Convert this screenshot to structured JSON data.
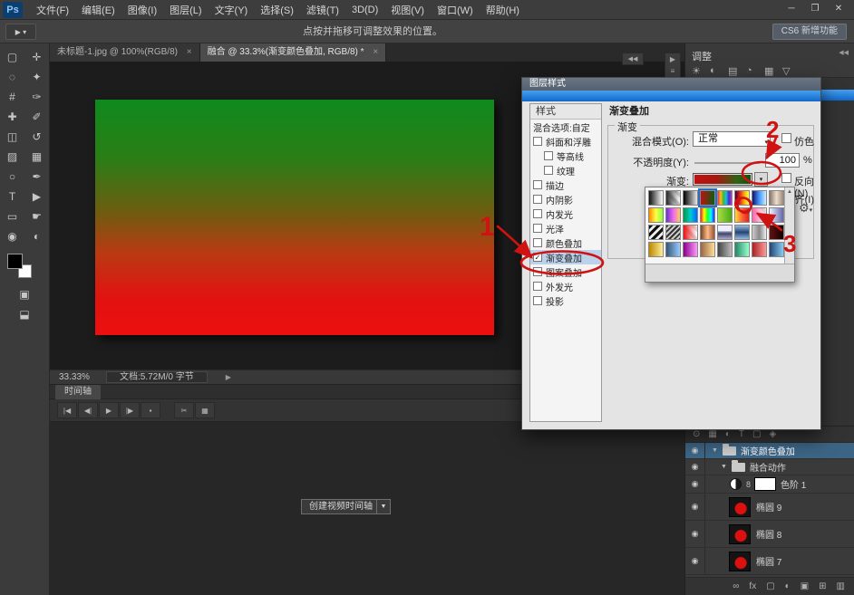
{
  "window": {
    "logo": "Ps",
    "controls": [
      {
        "name": "minimize",
        "glyph": "─"
      },
      {
        "name": "restore",
        "glyph": "❐"
      },
      {
        "name": "close",
        "glyph": "✕"
      }
    ]
  },
  "menu": {
    "items": [
      {
        "name": "file",
        "label": "文件(F)"
      },
      {
        "name": "edit",
        "label": "编辑(E)"
      },
      {
        "name": "image",
        "label": "图像(I)"
      },
      {
        "name": "layer",
        "label": "图层(L)"
      },
      {
        "name": "type",
        "label": "文字(Y)"
      },
      {
        "name": "select",
        "label": "选择(S)"
      },
      {
        "name": "filter",
        "label": "滤镜(T)"
      },
      {
        "name": "3d",
        "label": "3D(D)"
      },
      {
        "name": "view",
        "label": "视图(V)"
      },
      {
        "name": "window",
        "label": "窗口(W)"
      },
      {
        "name": "help",
        "label": "帮助(H)"
      }
    ]
  },
  "options_bar": {
    "hint": "点按并拖移可调整效果的位置。",
    "cs6_button": "CS6 新增功能",
    "tool_preset_glyph": "▶ ▾"
  },
  "glyphs": {
    "dropdown": "▼",
    "small_dropdown": "▾",
    "collapse": "◀◀",
    "expand": "▶",
    "menu_more": "≡",
    "check": "✓",
    "scroll_up": "▲",
    "scroll_down": "▼"
  },
  "tool_panel": {
    "tools": [
      {
        "name": "marquee-tool",
        "glyph": "▢"
      },
      {
        "name": "move-tool",
        "glyph": "✛"
      },
      {
        "name": "lasso-tool",
        "glyph": "◌"
      },
      {
        "name": "quick-select-tool",
        "glyph": "✦"
      },
      {
        "name": "crop-tool",
        "glyph": "#"
      },
      {
        "name": "eyedropper-tool",
        "glyph": "✑"
      },
      {
        "name": "healing-tool",
        "glyph": "✚"
      },
      {
        "name": "brush-tool",
        "glyph": "✐"
      },
      {
        "name": "clone-stamp-tool",
        "glyph": "◫"
      },
      {
        "name": "history-brush-tool",
        "glyph": "↺"
      },
      {
        "name": "eraser-tool",
        "glyph": "▨"
      },
      {
        "name": "gradient-tool",
        "glyph": "▦"
      },
      {
        "name": "blur-tool",
        "glyph": "○"
      },
      {
        "name": "pen-tool",
        "glyph": "✒"
      },
      {
        "name": "type-tool",
        "glyph": "T"
      },
      {
        "name": "path-select-tool",
        "glyph": "▶"
      },
      {
        "name": "shape-tool",
        "glyph": "▭"
      },
      {
        "name": "hand-tool",
        "glyph": "☛"
      },
      {
        "name": "zoom-tool",
        "glyph": "◉"
      },
      {
        "name": "dodge-tool",
        "glyph": "◐"
      }
    ],
    "extra": [
      {
        "name": "quick-mask-toggle",
        "glyph": "▣"
      },
      {
        "name": "screen-mode-toggle",
        "glyph": "⬓"
      }
    ]
  },
  "document_tabs": [
    {
      "label": "未标题-1.jpg @ 100%(RGB/8)",
      "close": "×"
    },
    {
      "label": "融合 @ 33.3%(渐变颜色叠加, RGB/8) *",
      "close": "×"
    }
  ],
  "canvas": {
    "image_style": "background:linear-gradient(180deg,#0f8a1c 0%,#2a7e16 25%,#6f5c10 48%,#b93a12 65%,#e31111 85%,#ec0f0f 100%)"
  },
  "status_bar": {
    "zoom": "33.33%",
    "doc_info": "文档:5.72M/0 字节",
    "expand_glyph": "▶"
  },
  "timeline": {
    "tab_label": "时间轴",
    "transport": [
      {
        "name": "go-to-first-frame",
        "glyph": "|◀"
      },
      {
        "name": "previous-frame",
        "glyph": "◀|"
      },
      {
        "name": "play",
        "glyph": "▶"
      },
      {
        "name": "next-frame",
        "glyph": "|▶"
      },
      {
        "name": "mute-audio",
        "glyph": "▪"
      }
    ],
    "tools": [
      {
        "name": "split-clip",
        "glyph": "✂"
      },
      {
        "name": "transition",
        "glyph": "▦"
      }
    ],
    "create_button": "创建视频时间轴",
    "create_dropdown_glyph": "▼"
  },
  "panels_right": {
    "adjustments_tab": "调整",
    "collapse_glyph": "◀◀",
    "adjust_icons": [
      {
        "name": "brightness-adjustment-icon",
        "glyph": "☀"
      },
      {
        "name": "levels-adjustment-icon",
        "glyph": "◐"
      },
      {
        "name": "curves-adjustment-icon",
        "glyph": "▤"
      },
      {
        "name": "exposure-adjustment-icon",
        "glyph": "◔"
      },
      {
        "name": "vibrance-adjustment-icon",
        "glyph": "▦"
      },
      {
        "name": "hue-adjustment-icon",
        "glyph": "▽"
      }
    ]
  },
  "dialog": {
    "title": "图层样式",
    "styles_header": "样式",
    "styles": [
      {
        "label": "混合选项:自定",
        "has_checkbox": false,
        "checked": false,
        "indent": false,
        "selected": false
      },
      {
        "label": "斜面和浮雕",
        "has_checkbox": true,
        "checked": false,
        "indent": false,
        "selected": false
      },
      {
        "label": "等高线",
        "has_checkbox": true,
        "checked": false,
        "indent": true,
        "selected": false
      },
      {
        "label": "纹理",
        "has_checkbox": true,
        "checked": false,
        "indent": true,
        "selected": false
      },
      {
        "label": "描边",
        "has_checkbox": true,
        "checked": false,
        "indent": false,
        "selected": false
      },
      {
        "label": "内阴影",
        "has_checkbox": true,
        "checked": false,
        "indent": false,
        "selected": false
      },
      {
        "label": "内发光",
        "has_checkbox": true,
        "checked": false,
        "indent": false,
        "selected": false
      },
      {
        "label": "光泽",
        "has_checkbox": true,
        "checked": false,
        "indent": false,
        "selected": false
      },
      {
        "label": "颜色叠加",
        "has_checkbox": true,
        "checked": false,
        "indent": false,
        "selected": false
      },
      {
        "label": "渐变叠加",
        "has_checkbox": true,
        "checked": true,
        "indent": false,
        "selected": true
      },
      {
        "label": "图案叠加",
        "has_checkbox": true,
        "checked": false,
        "indent": false,
        "selected": false
      },
      {
        "label": "外发光",
        "has_checkbox": true,
        "checked": false,
        "indent": false,
        "selected": false
      },
      {
        "label": "投影",
        "has_checkbox": true,
        "checked": false,
        "indent": false,
        "selected": false
      }
    ],
    "panel": {
      "heading": "渐变叠加",
      "section_label": "渐变",
      "blend_mode_label": "混合模式(O):",
      "blend_mode_value": "正常",
      "dither_label": "仿色",
      "opacity_label": "不透明度(Y):",
      "opacity_value": "100",
      "opacity_unit": "%",
      "gradient_label": "渐变:",
      "gradient_style": "background:linear-gradient(90deg,#c01111 0%,#a81610 40%,#2f6413 75%,#0e4f12 100%)",
      "reverse_label": "反向(N)",
      "align_label": "与图层对齐(I)"
    }
  },
  "gradient_picker": {
    "gear_glyph": "⚙",
    "swatches": [
      {
        "name": "black-white",
        "css": "linear-gradient(90deg,#111,#fff)"
      },
      {
        "name": "fg-to-transparent",
        "css": "linear-gradient(90deg,#2a2a2a,rgba(255,255,255,0)),repeating-linear-gradient(45deg,#cfcfcf 0 4px,#fff 4px 8px)"
      },
      {
        "name": "black-white-2",
        "css": "linear-gradient(90deg,#000,#e8e8e8)"
      },
      {
        "name": "red-green",
        "selected": true,
        "css": "linear-gradient(90deg,#c01010,#0d5c12)"
      },
      {
        "name": "spectrum",
        "css": "linear-gradient(90deg,#e33,#fb2,#3b3,#2bd,#33c,#c3c)"
      },
      {
        "name": "dark-spectrum",
        "css": "linear-gradient(90deg,#402,#d22,#fa0,#ff5)"
      },
      {
        "name": "blue-sky",
        "css": "linear-gradient(90deg,#116,#49f,#cef)"
      },
      {
        "name": "neutral-metal",
        "css": "linear-gradient(90deg,#876,#edc,#987)"
      },
      {
        "name": "orange-yellow-green",
        "css": "linear-gradient(90deg,#f80,#ff4,#8f4)"
      },
      {
        "name": "violet-pink-gold",
        "css": "linear-gradient(90deg,#63c,#e6e,#fc6)"
      },
      {
        "name": "green-cyan-blue",
        "css": "linear-gradient(90deg,#094,#0cc,#06f)"
      },
      {
        "name": "bright-rainbow",
        "css": "linear-gradient(90deg,#f22,#ff0,#2f2,#0ff,#22f)"
      },
      {
        "name": "green-lime",
        "css": "linear-gradient(90deg,#ad4,#4a1)"
      },
      {
        "name": "yellow-orange-red",
        "css": "linear-gradient(90deg,#fd3,#f63,#d22)"
      },
      {
        "name": "pink-transparent",
        "css": "linear-gradient(90deg,#f6a,rgba(255,255,255,0)),repeating-linear-gradient(45deg,#ddd 0 4px,#fff 4px 8px)"
      },
      {
        "name": "white-blue",
        "css": "linear-gradient(90deg,#eef,#66a)"
      },
      {
        "name": "stripes-coarse",
        "css": "repeating-linear-gradient(135deg,#111 0 3px,#eee 3px 6px)"
      },
      {
        "name": "stripes-fine",
        "css": "repeating-linear-gradient(135deg,#333 0 2px,#ccc 2px 4px)"
      },
      {
        "name": "red-transparent",
        "css": "linear-gradient(90deg,#e11,rgba(255,255,255,0)),repeating-linear-gradient(45deg,#ddd 0 4px,#fff 4px 8px)"
      },
      {
        "name": "copper",
        "css": "linear-gradient(90deg,#742,#fb8,#953)"
      },
      {
        "name": "chrome",
        "css": "linear-gradient(180deg,#eef 0 40%,#89b 45%,#446 60%,#aac)"
      },
      {
        "name": "steel-blue",
        "css": "linear-gradient(180deg,#9bd,#247,#9bd)"
      },
      {
        "name": "silver",
        "css": "linear-gradient(90deg,#ccc,#888,#eee)"
      },
      {
        "name": "dark-red-black",
        "css": "linear-gradient(90deg,#611,#100)"
      },
      {
        "name": "gold",
        "css": "linear-gradient(90deg,#b80,#fe9)"
      },
      {
        "name": "blue-light",
        "css": "linear-gradient(90deg,#357,#9cf)"
      },
      {
        "name": "purple-magenta",
        "css": "linear-gradient(90deg,#808,#f9f)"
      },
      {
        "name": "brown-tan",
        "css": "linear-gradient(90deg,#964,#fd9)"
      },
      {
        "name": "gray",
        "css": "linear-gradient(90deg,#444,#bbb)"
      },
      {
        "name": "teal-mint",
        "css": "linear-gradient(90deg,#286,#9fc)"
      },
      {
        "name": "red-rose",
        "css": "linear-gradient(90deg,#a22,#f99)"
      },
      {
        "name": "navy-azure",
        "css": "linear-gradient(90deg,#247,#8ce)"
      }
    ]
  },
  "layers_panel": {
    "eye_glyph": "◉",
    "shape_thumb_style": "background:radial-gradient(circle at 55% 58%, #dd1010 0 6px, rgba(0,0,0,0) 7px),#141414",
    "filter_icons": [
      {
        "name": "filter-kind",
        "glyph": "⊙"
      },
      {
        "name": "filter-image",
        "glyph": "▦"
      },
      {
        "name": "filter-adjustment",
        "glyph": "◐"
      },
      {
        "name": "filter-type",
        "glyph": "T"
      },
      {
        "name": "filter-shape",
        "glyph": "▢"
      },
      {
        "name": "filter-smart-object",
        "glyph": "◈"
      }
    ],
    "rows": [
      {
        "type": "group",
        "name": "渐变颜色叠加",
        "selected": true,
        "twirl": "▼",
        "indent": 0
      },
      {
        "type": "group",
        "name": "融合动作",
        "selected": false,
        "twirl": "▼",
        "indent": 1
      },
      {
        "type": "adjustment",
        "name": "色阶 1",
        "selected": false,
        "indent": 2,
        "link_glyph": "8"
      },
      {
        "type": "shape",
        "name": "椭圆 9",
        "selected": false,
        "indent": 2
      },
      {
        "type": "shape",
        "name": "椭圆 8",
        "selected": false,
        "indent": 2
      },
      {
        "type": "shape",
        "name": "椭圆 7",
        "selected": false,
        "indent": 2
      }
    ],
    "bottom_icons": [
      {
        "name": "link-layers",
        "glyph": "∞"
      },
      {
        "name": "layer-effects",
        "glyph": "fx"
      },
      {
        "name": "add-layer-mask",
        "glyph": "▢"
      },
      {
        "name": "new-adjustment-layer",
        "glyph": "◐"
      },
      {
        "name": "new-group",
        "glyph": "▣"
      },
      {
        "name": "new-layer",
        "glyph": "⊞"
      },
      {
        "name": "delete-layer",
        "glyph": "▥"
      }
    ]
  },
  "annotations": {
    "one": "1",
    "two": "2",
    "three": "3"
  }
}
